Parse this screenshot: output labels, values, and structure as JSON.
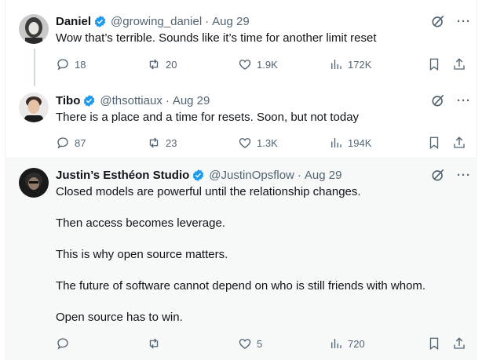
{
  "posts": [
    {
      "name": "Daniel",
      "handle": "@growing_daniel",
      "date": "Aug 29",
      "text": [
        "Wow that’s terrible. Sounds like it’s time for another limit reset"
      ],
      "replies": "18",
      "reposts": "20",
      "likes": "1.9K",
      "views": "172K"
    },
    {
      "name": "Tibo",
      "handle": "@thsottiaux",
      "date": "Aug 29",
      "text": [
        "There is a place and a time for resets. Soon, but not today"
      ],
      "replies": "87",
      "reposts": "23",
      "likes": "1.3K",
      "views": "194K"
    },
    {
      "name": "Justin’s Esthéon Studio",
      "handle": "@JustinOpsflow",
      "date": "Aug 29",
      "text": [
        "Closed models are powerful until the relationship changes.",
        "Then access becomes leverage.",
        "This is why open source matters.",
        "The future of software cannot depend on who is still friends with whom.",
        "Open source has to win."
      ],
      "replies": "",
      "reposts": "",
      "likes": "5",
      "views": "720"
    }
  ],
  "separator": "·",
  "more_glyph": "···",
  "icons": {
    "verified": "verified-badge-icon",
    "grok": "grok-icon",
    "more": "more-icon",
    "reply": "reply-icon",
    "repost": "repost-icon",
    "like": "like-icon",
    "views": "views-icon",
    "bookmark": "bookmark-icon",
    "share": "share-icon"
  },
  "colors": {
    "verified": "#1d9bf0",
    "secondary": "#536471",
    "highlight_bg": "#f7f9f9"
  }
}
